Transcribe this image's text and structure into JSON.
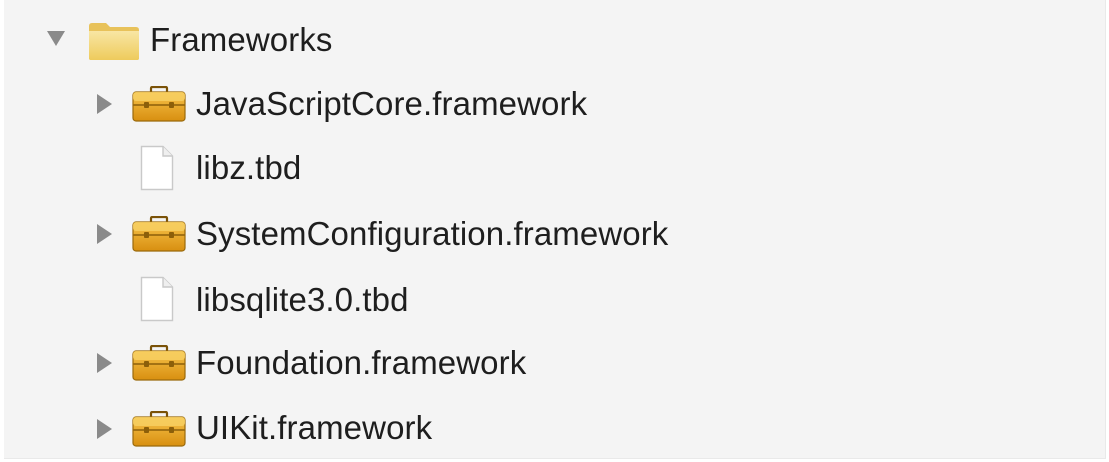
{
  "tree": {
    "root": {
      "label": "Frameworks",
      "expanded": true,
      "icon": "folder-icon",
      "children": [
        {
          "label": "JavaScriptCore.framework",
          "icon": "toolbox-icon",
          "expandable": true,
          "expanded": false
        },
        {
          "label": "libz.tbd",
          "icon": "file-icon",
          "expandable": false
        },
        {
          "label": "SystemConfiguration.framework",
          "icon": "toolbox-icon",
          "expandable": true,
          "expanded": false
        },
        {
          "label": "libsqlite3.0.tbd",
          "icon": "file-icon",
          "expandable": false
        },
        {
          "label": "Foundation.framework",
          "icon": "toolbox-icon",
          "expandable": true,
          "expanded": false
        },
        {
          "label": "UIKit.framework",
          "icon": "toolbox-icon",
          "expandable": true,
          "expanded": false
        }
      ]
    }
  },
  "colors": {
    "panel_background": "#f4f4f4",
    "text": "#1e1e1e",
    "disclosure": "#8a8a8a",
    "folder": "#f3d77a",
    "toolbox": "#e3a21a"
  }
}
